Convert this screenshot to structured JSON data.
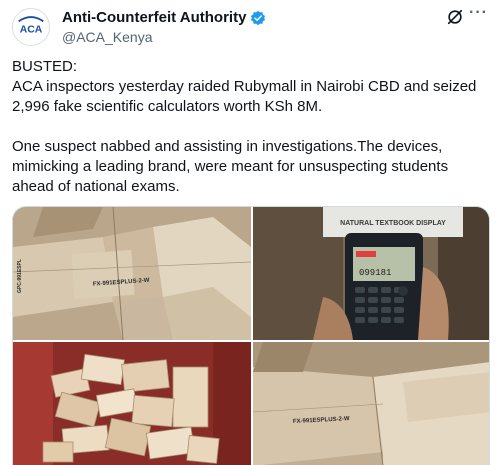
{
  "author": {
    "display_name": "Anti-Counterfeit Authority",
    "handle": "@ACA_Kenya",
    "avatar_text": "ACA",
    "verified_icon": "verified-badge-icon",
    "colors": {
      "verified": "#1d9bf0",
      "avatar_text": "#1a4fa0"
    }
  },
  "actions": {
    "more_label": "···",
    "grok_icon": "grok-icon"
  },
  "tweet": {
    "line1": "BUSTED:",
    "line2": "ACA inspectors yesterday raided Rubymall in Nairobi CBD and seized 2,996 fake scientific calculators worth KSh 8M.",
    "line3": "One suspect nabbed and assisting in investigations.The devices, mimicking a leading brand, were meant for unsuspecting students ahead of national exams."
  },
  "media": {
    "photo1": {
      "box_text_1": "FX-991ESPLUS-2-W",
      "box_text_2": "GPC-991ESPL"
    },
    "photo2": {
      "box_header": "NATURAL TEXTBOOK DISPLAY",
      "screen_text": "099181"
    },
    "photo4": {
      "box_text_1": "FX-991ESPLUS-2-W"
    }
  }
}
